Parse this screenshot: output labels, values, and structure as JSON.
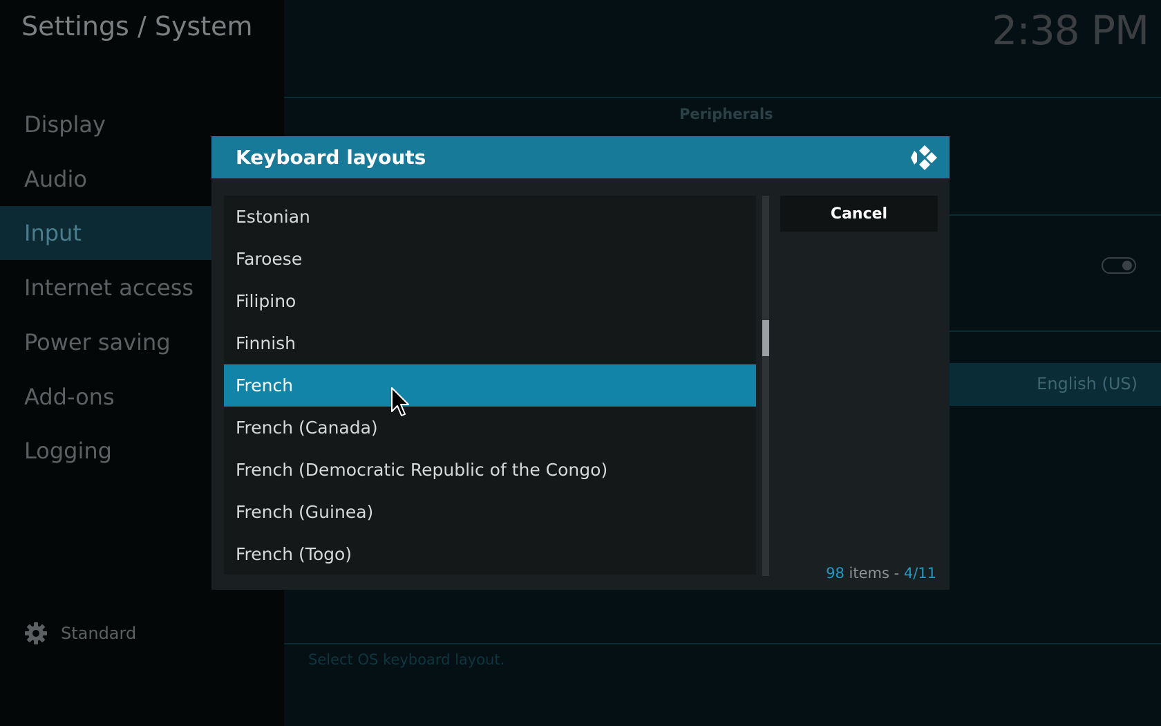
{
  "header": {
    "title": "Settings / System",
    "clock": "2:38 PM"
  },
  "sidebar": {
    "items": [
      {
        "label": "Display"
      },
      {
        "label": "Audio"
      },
      {
        "label": "Input"
      },
      {
        "label": "Internet access"
      },
      {
        "label": "Power saving"
      },
      {
        "label": "Add-ons"
      },
      {
        "label": "Logging"
      }
    ],
    "active_index": 2,
    "settings_level": "Standard"
  },
  "background": {
    "section_title": "Peripherals",
    "setting_value": "English (US)",
    "hint": "Select OS keyboard layout."
  },
  "dialog": {
    "title": "Keyboard layouts",
    "items": [
      {
        "label": "Estonian"
      },
      {
        "label": "Faroese"
      },
      {
        "label": "Filipino"
      },
      {
        "label": "Finnish"
      },
      {
        "label": "French"
      },
      {
        "label": "French (Canada)"
      },
      {
        "label": "French (Democratic Republic of the Congo)"
      },
      {
        "label": "French (Guinea)"
      },
      {
        "label": "French (Togo)"
      }
    ],
    "selected_index": 4,
    "cancel_label": "Cancel",
    "footer": {
      "count": "98",
      "items_word": " items - ",
      "page": "4/11"
    }
  },
  "icons": {
    "settings_level": "gear-icon",
    "logo": "kodi-logo-icon",
    "pointer": "mouse-cursor-icon"
  },
  "colors": {
    "accent": "#177a99",
    "selected": "#1184a8",
    "count_accent": "#1e9bc4"
  }
}
